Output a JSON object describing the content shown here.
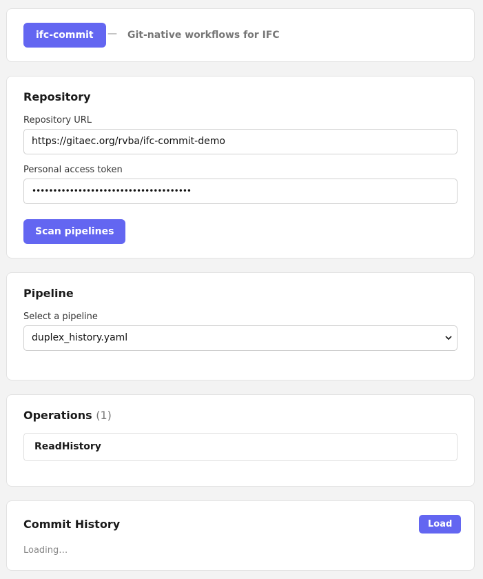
{
  "header": {
    "brand_label": "ifc-commit",
    "separator": "—",
    "tagline": "Git-native workflows for IFC"
  },
  "repository": {
    "title": "Repository",
    "url_label": "Repository URL",
    "url_value": "https://gitaec.org/rvba/ifc-commit-demo",
    "token_label": "Personal access token",
    "token_value": "••••••••••••••••••••••••••••••••••••••",
    "scan_button": "Scan pipelines"
  },
  "pipeline": {
    "title": "Pipeline",
    "select_label": "Select a pipeline",
    "selected": "duplex_history.yaml"
  },
  "operations": {
    "title": "Operations",
    "count": "(1)",
    "items": [
      "ReadHistory"
    ]
  },
  "history": {
    "title": "Commit History",
    "load_button": "Load",
    "status": "Loading…"
  },
  "colors": {
    "accent": "#6366f1",
    "background": "#f3f3f3"
  }
}
